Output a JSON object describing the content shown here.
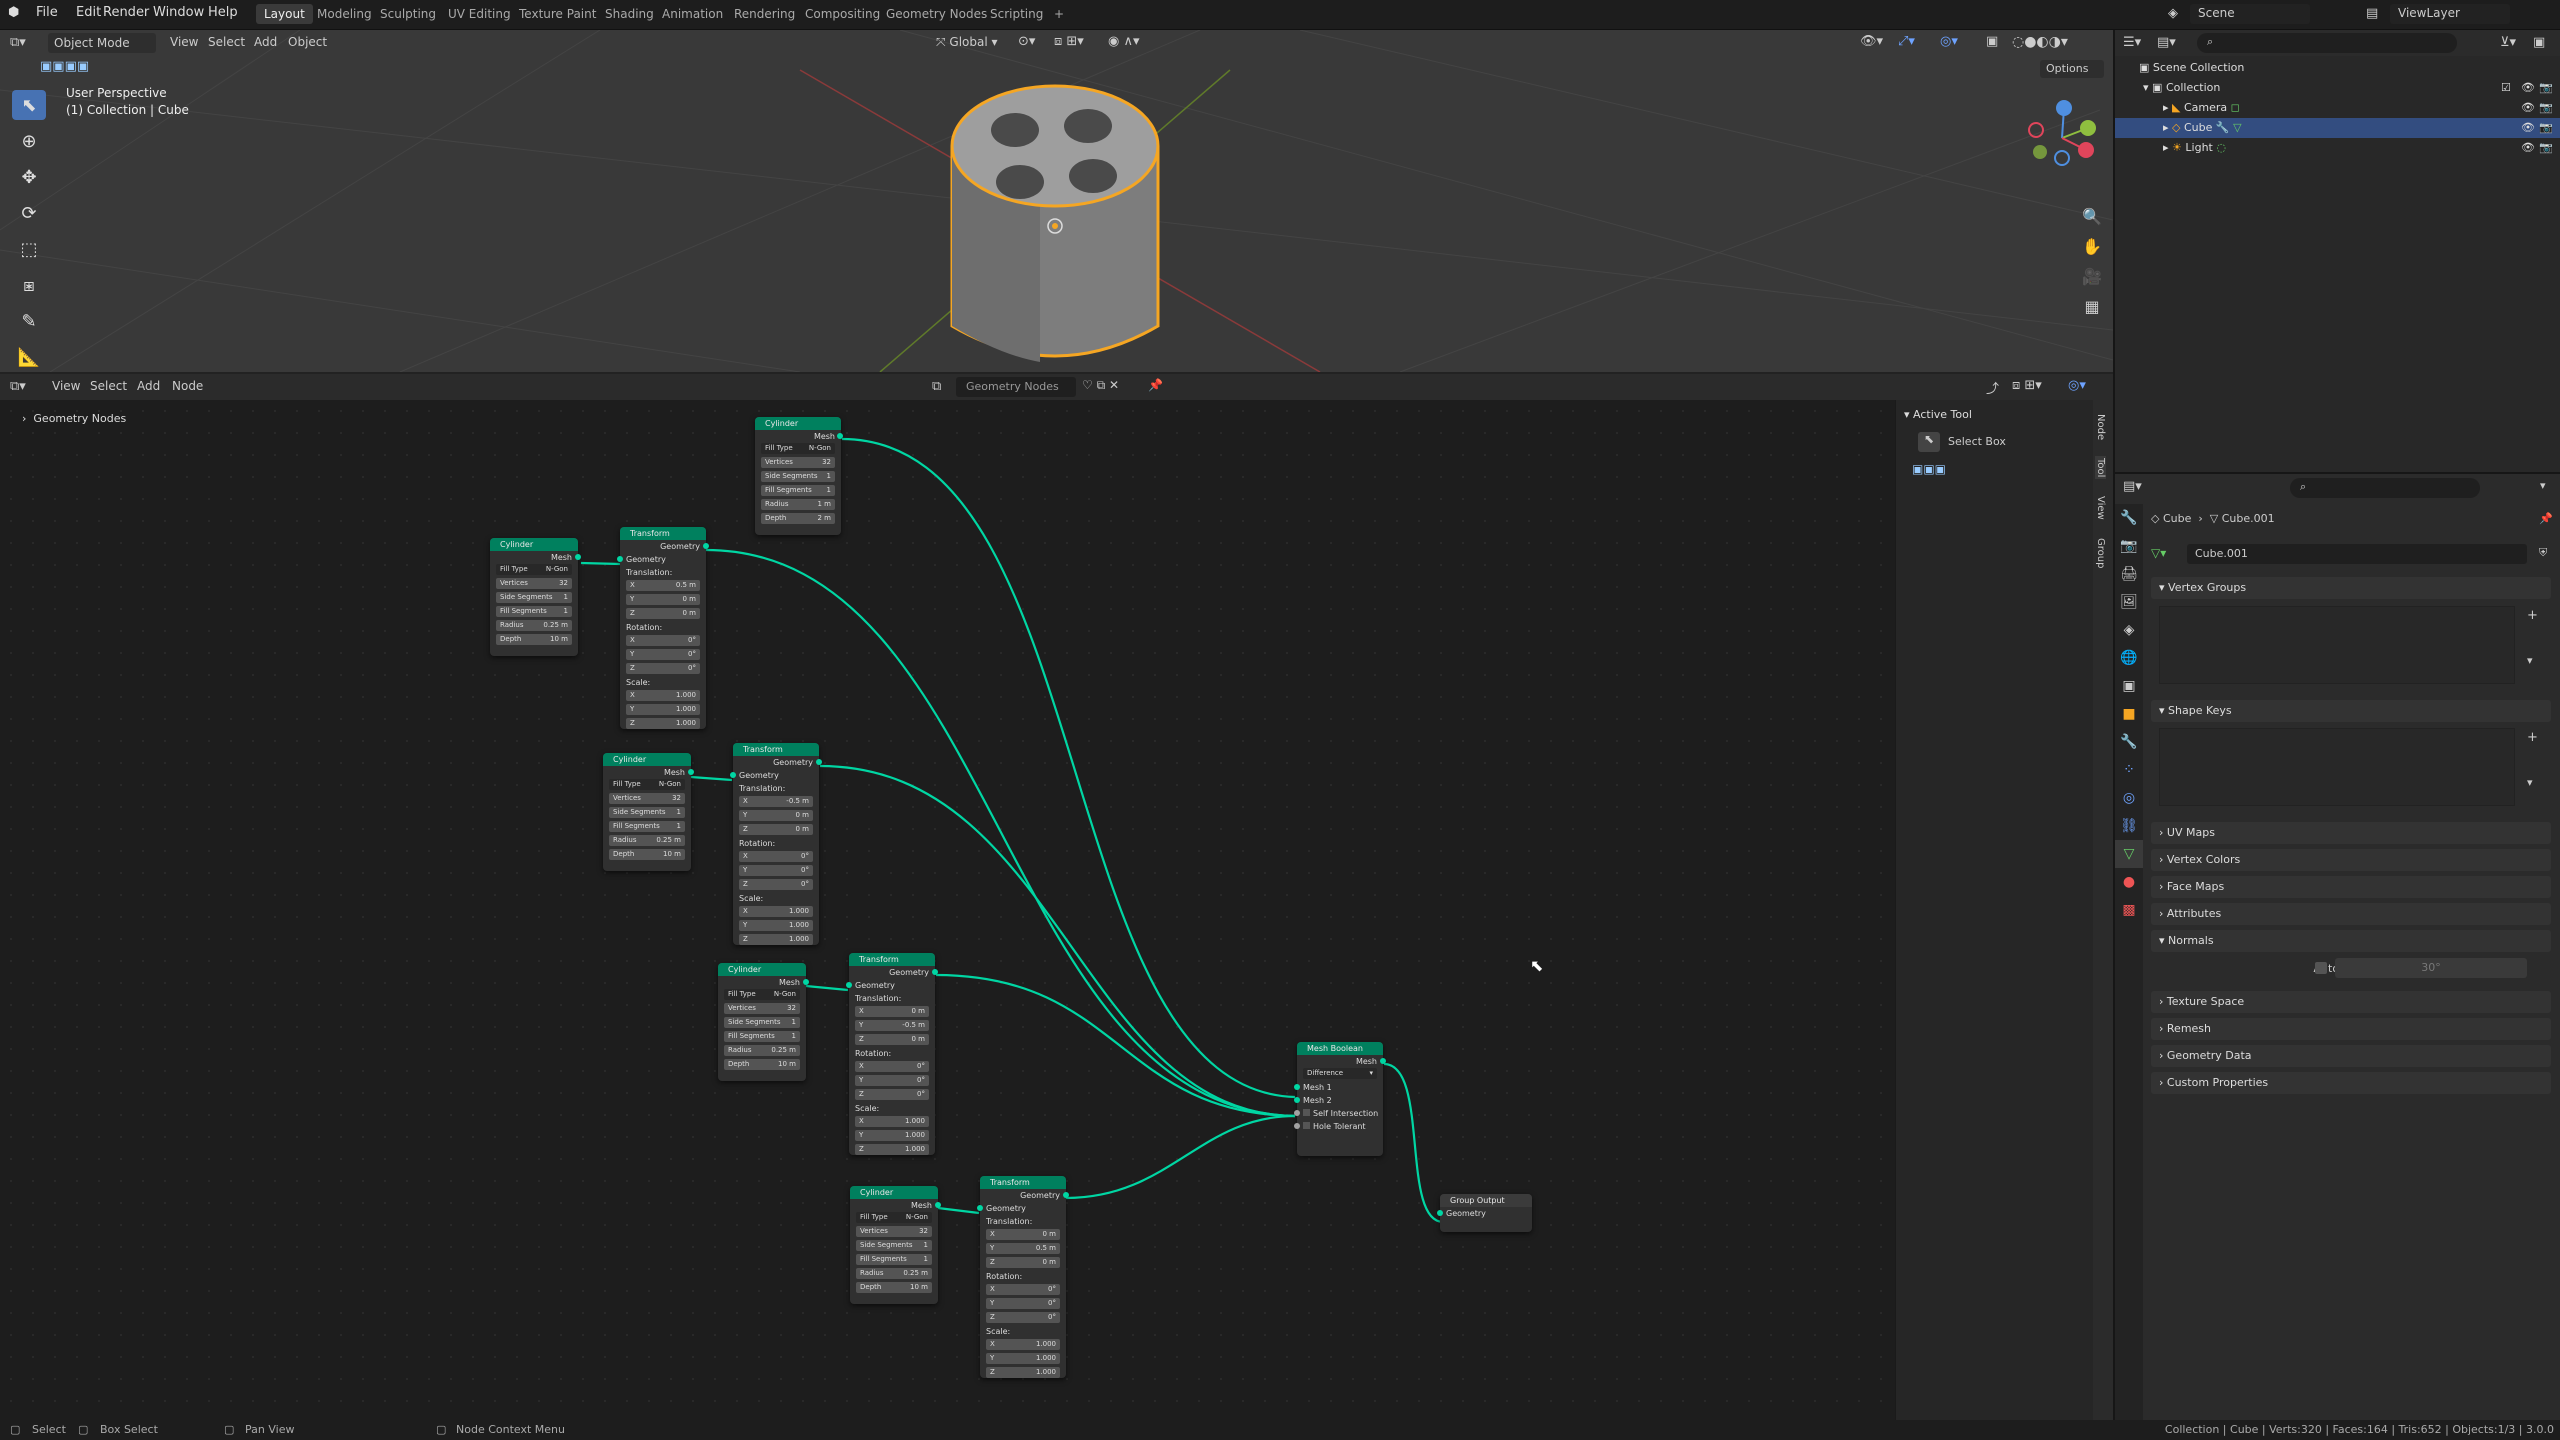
{
  "topbar": {
    "menus": [
      "File",
      "Edit",
      "Render",
      "Window",
      "Help"
    ],
    "workspaces": [
      "Layout",
      "Modeling",
      "Sculpting",
      "UV Editing",
      "Texture Paint",
      "Shading",
      "Animation",
      "Rendering",
      "Compositing",
      "Geometry Nodes",
      "Scripting"
    ],
    "active_workspace": "Layout",
    "scene": "Scene",
    "view_layer": "ViewLayer"
  },
  "viewport": {
    "mode": "Object Mode",
    "menus": [
      "View",
      "Select",
      "Add",
      "Object"
    ],
    "transform": "Global",
    "options": "Options",
    "perspective": "User Perspective",
    "context": "(1) Collection | Cube"
  },
  "node_editor": {
    "menus": [
      "View",
      "Select",
      "Add",
      "Node"
    ],
    "tree_name": "Geometry Nodes",
    "breadcrumb": "Geometry Nodes",
    "sidebar": {
      "active_tool": "Active Tool",
      "select_box": "Select Box"
    },
    "tabs": [
      "Node",
      "Tool",
      "View",
      "Group"
    ]
  },
  "nodes": {
    "cylinder": {
      "title": "Cylinder",
      "mesh": "Mesh",
      "fill_type": "Fill Type",
      "fill_value": "N-Gon",
      "vertices": "Vertices",
      "vertices_v": "32",
      "side_segments": "Side Segments",
      "side_v": "1",
      "fill_segments": "Fill Segments",
      "fill_seg_v": "1",
      "radius": "Radius",
      "depth": "Depth"
    },
    "transform": {
      "title": "Transform",
      "geometry": "Geometry",
      "translation": "Translation:",
      "rotation": "Rotation:",
      "scale": "Scale:",
      "x": "X",
      "y": "Y",
      "z": "Z",
      "zero_m": "0 m",
      "deg": "0°",
      "one": "1.000"
    },
    "c_top": {
      "radius": "1 m",
      "depth": "2 m"
    },
    "c_small": {
      "radius": "0.25 m",
      "depth": "10 m"
    },
    "t1": {
      "tx": "0.5 m"
    },
    "t2": {
      "tx": "-0.5 m"
    },
    "t3": {
      "ty": "-0.5 m"
    },
    "t4": {
      "ty": "0.5 m"
    },
    "boolean": {
      "title": "Mesh Boolean",
      "mesh": "Mesh",
      "operation": "Difference",
      "mesh1": "Mesh 1",
      "mesh2": "Mesh 2",
      "self_intersection": "Self Intersection",
      "hole_tolerant": "Hole Tolerant"
    },
    "group_output": {
      "title": "Group Output",
      "geometry": "Geometry"
    }
  },
  "outliner": {
    "root": "Scene Collection",
    "collection": "Collection",
    "items": [
      "Camera",
      "Cube",
      "Light"
    ]
  },
  "properties": {
    "object": "Cube",
    "mesh": "Cube.001",
    "panels": [
      "Vertex Groups",
      "Shape Keys",
      "UV Maps",
      "Vertex Colors",
      "Face Maps",
      "Attributes",
      "Normals",
      "Texture Space",
      "Remesh",
      "Geometry Data",
      "Custom Properties"
    ],
    "auto_smooth": "Auto Smooth",
    "auto_smooth_angle": "30°"
  },
  "statusbar": {
    "select": "Select",
    "box_select": "Box Select",
    "pan_view": "Pan View",
    "context_menu": "Node Context Menu",
    "stats": "Collection | Cube | Verts:320 | Faces:164 | Tris:652 | Objects:1/3 | 3.0.0"
  },
  "colors": {
    "node_header": "#00805e",
    "link": "#00d6a3",
    "selected": "#4772b3",
    "active_orange": "#f5a623"
  }
}
